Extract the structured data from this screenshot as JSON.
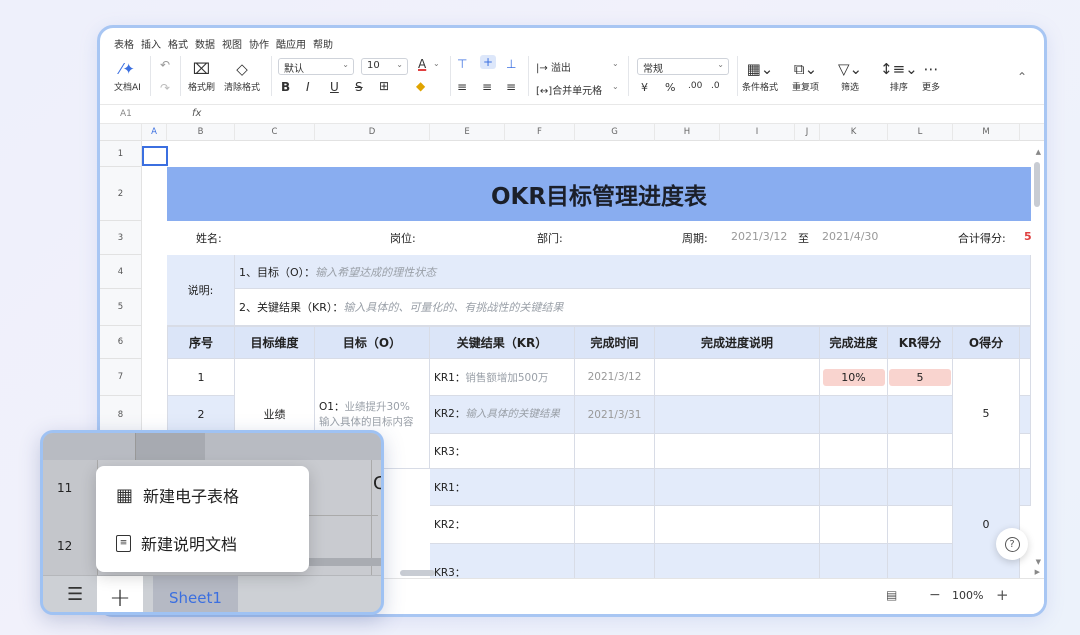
{
  "menubar": [
    "表格",
    "插入",
    "格式",
    "数据",
    "视图",
    "协作",
    "酷应用",
    "帮助"
  ],
  "toolbar": {
    "doc_ai": "文档AI",
    "format_brush": "格式刷",
    "clear_format": "清除格式",
    "font": "默认",
    "size": "10",
    "bold": "B",
    "italic": "I",
    "underline": "U",
    "strike": "S",
    "overflow": "溢出",
    "merge": "合并单元格",
    "number_format": "常规",
    "currency": "¥",
    "percent": "%",
    "dec_inc": ".00",
    "dec_dec": ".0",
    "cond_format": "条件格式",
    "dup": "重复项",
    "filter": "筛选",
    "sort": "排序",
    "more": "更多"
  },
  "formula": {
    "cell": "A1",
    "fx": "fx"
  },
  "columns": [
    "A",
    "B",
    "C",
    "D",
    "E",
    "F",
    "G",
    "H",
    "I",
    "J",
    "K",
    "L",
    "M"
  ],
  "rows": [
    "1",
    "2",
    "3",
    "4",
    "5",
    "6",
    "7",
    "8"
  ],
  "sheet": {
    "title": "OKR目标管理进度表",
    "info": {
      "name": "姓名:",
      "post": "岗位:",
      "dept": "部门:",
      "period": "周期:",
      "start": "2021/3/12",
      "to": "至",
      "end": "2021/4/30",
      "score_label": "合计得分:",
      "score": "5"
    },
    "desc": {
      "label": "说明:",
      "line1": "1、目标（O）：",
      "line1_ph": "输入希望达成的理性状态",
      "line2": "2、关键结果（KR）：",
      "line2_ph": "输入具体的、可量化的、有挑战性的关键结果"
    },
    "headers": [
      "序号",
      "目标维度",
      "目标（O）",
      "关键结果（KR）",
      "完成时间",
      "完成进度说明",
      "完成进度",
      "KR得分",
      "O得分"
    ],
    "dimension": "业绩",
    "objective": "O1：",
    "objective_ph": "业绩提升30%",
    "objective_ph2": "输入具体的目标内容",
    "rows": [
      {
        "no": "1",
        "kr": "KR1：",
        "kr_ph": "销售额增加500万",
        "time": "2021/3/12",
        "progress": "10%",
        "kr_score": "5"
      },
      {
        "no": "2",
        "kr": "KR2：",
        "kr_ph": "输入具体的关键结果",
        "time": "2021/3/31",
        "progress": "",
        "kr_score": ""
      },
      {
        "no": "",
        "kr": "KR3：",
        "kr_ph": "",
        "time": "",
        "progress": "",
        "kr_score": ""
      }
    ],
    "o_score": "5",
    "lower_rows": [
      {
        "kr": "KR1："
      },
      {
        "kr": "KR2："
      },
      {
        "kr": "KR3："
      }
    ],
    "o_score2": "0"
  },
  "popup": {
    "row11": "11",
    "row12": "12",
    "letter": "C",
    "new_sheet": "新建电子表格",
    "new_doc": "新建说明文档",
    "sheet_tab": "Sheet1"
  },
  "bottom": {
    "zoom": "100%",
    "minus": "−",
    "plus": "+",
    "help": "?"
  }
}
